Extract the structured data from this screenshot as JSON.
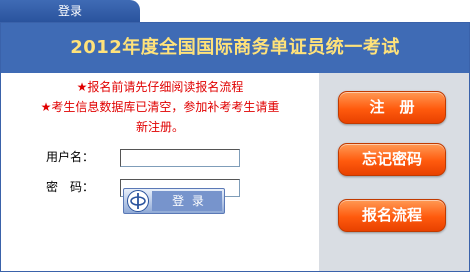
{
  "tab": {
    "label": "登录"
  },
  "banner": {
    "title": "2012年度全国国际商务单证员统一考试"
  },
  "notice": {
    "line1_star": "★",
    "line1": "报名前请先仔细阅读报名流程",
    "line2_star": "★",
    "line2": "考生信息数据库已清空，参加补考考生请重",
    "line3": "新注册。"
  },
  "form": {
    "username_label": "用户名：",
    "username_value": "",
    "password_label": "密　码：",
    "password_value": "",
    "login_label": "登 录"
  },
  "actions": {
    "register": "注　册",
    "forgot_password": "忘记密码",
    "process": "报名流程"
  },
  "colors": {
    "banner": "#3f6bb5",
    "title": "#ffe27a",
    "notice": "#e00000",
    "action_button": "#ff5a0d",
    "side_panel": "#d9dde3"
  }
}
